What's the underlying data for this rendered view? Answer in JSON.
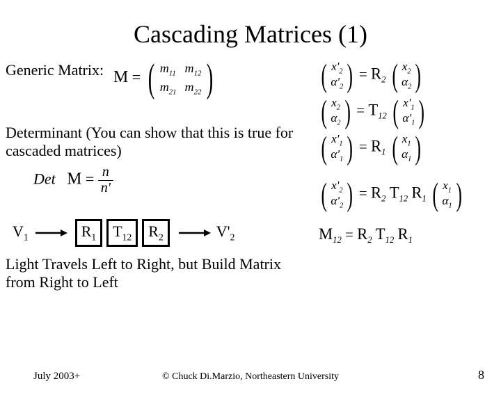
{
  "title": "Cascading Matrices (1)",
  "left": {
    "generic_label": "Generic Matrix:",
    "determinant_label": "Determinant (You can show that this is true for cascaded matrices)",
    "cascade": {
      "v1": "V",
      "v1_sub": "1",
      "r1": "R",
      "r1_sub": "1",
      "t12": "T",
      "t12_sub": "12",
      "r2": "R",
      "r2_sub": "2",
      "v2": "V'",
      "v2_sub": "2"
    },
    "light_text": "Light Travels Left to Right, but Build Matrix from Right to Left"
  },
  "math": {
    "M": "M",
    "eq": "=",
    "m11": "m",
    "m11s": "11",
    "m12": "m",
    "m12s": "12",
    "m21": "m",
    "m21s": "21",
    "m22": "m",
    "m22s": "22",
    "Det": "Det",
    "n": "n",
    "nprime": "n'",
    "x2p": "x'",
    "x2p_s": "2",
    "a2p": "α'",
    "a2p_s": "2",
    "x2": "x",
    "x2_s": "2",
    "a2": "α",
    "a2_s": "2",
    "x1p": "x'",
    "x1p_s": "1",
    "a1p": "α'",
    "a1p_s": "1",
    "x1": "x",
    "x1_s": "1",
    "a1": "α",
    "a1_s": "1",
    "R2": "R",
    "R2s": "2",
    "T12": "T",
    "T12s": "12",
    "R1": "R",
    "R1s": "1",
    "M12": "M",
    "M12s": "12"
  },
  "footer": {
    "date": "July 2003+",
    "copyright": "© Chuck Di.Marzio, Northeastern University",
    "page": "8"
  }
}
